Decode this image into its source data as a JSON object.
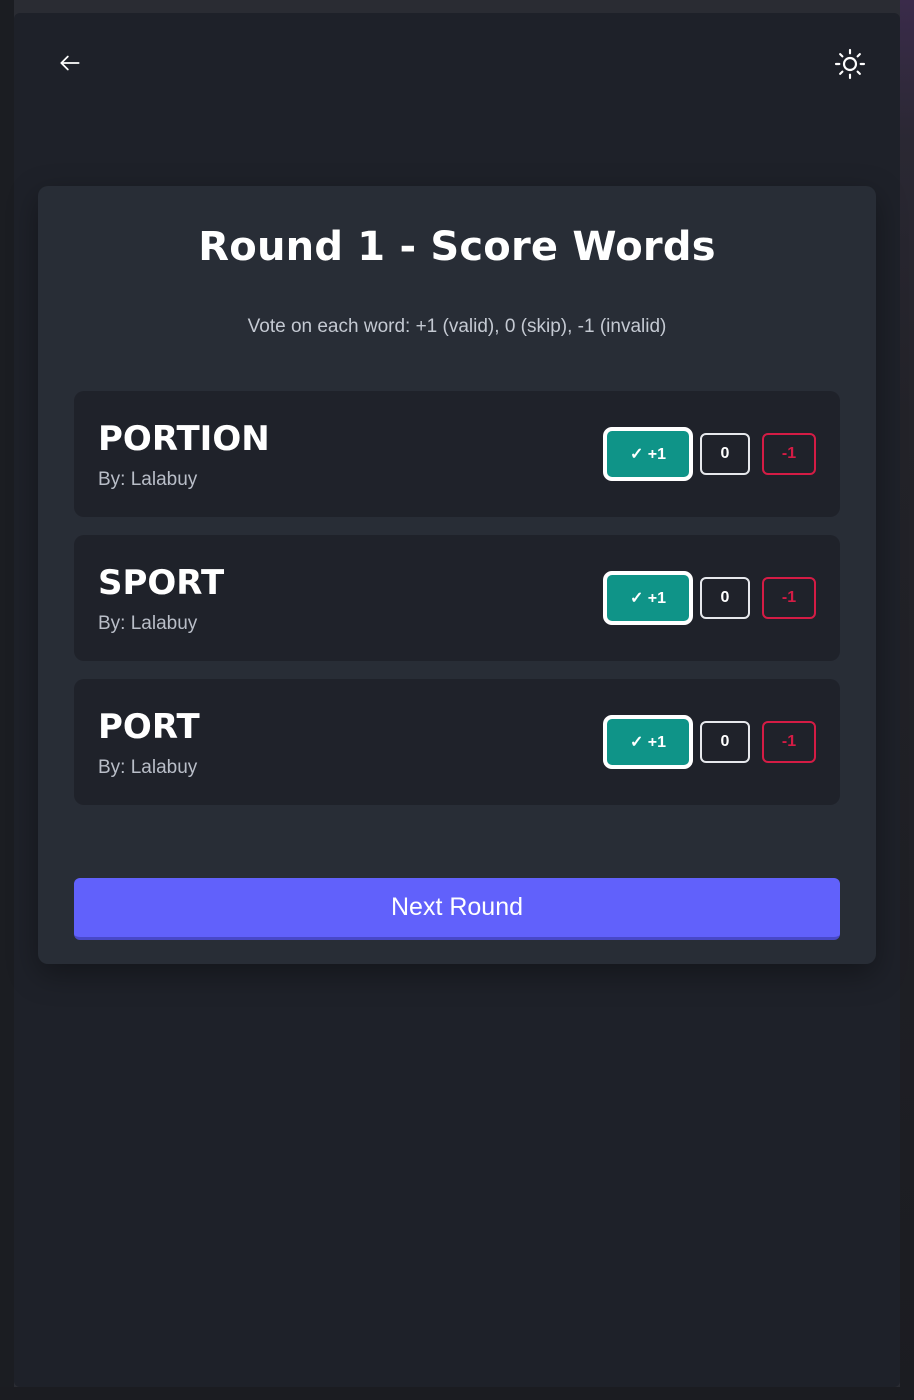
{
  "header": {
    "back_icon": "arrow-left-icon",
    "theme_icon": "sun-icon"
  },
  "card": {
    "title": "Round 1 - Score Words",
    "subtitle": "Vote on each word: +1 (valid), 0 (skip), -1 (invalid)"
  },
  "words": [
    {
      "word": "PORTION",
      "by": "By: Lalabuy",
      "plus_label": "✓ +1",
      "zero_label": "0",
      "minus_label": "-1",
      "selected": "+1"
    },
    {
      "word": "SPORT",
      "by": "By: Lalabuy",
      "plus_label": "✓ +1",
      "zero_label": "0",
      "minus_label": "-1",
      "selected": "+1"
    },
    {
      "word": "PORT",
      "by": "By: Lalabuy",
      "plus_label": "✓ +1",
      "zero_label": "0",
      "minus_label": "-1",
      "selected": "+1"
    }
  ],
  "next_button": {
    "label": "Next Round"
  },
  "colors": {
    "accent": "#6161fb",
    "valid": "#0f9488",
    "invalid": "#d41c45",
    "card": "#282d36",
    "background": "#1e2129"
  }
}
